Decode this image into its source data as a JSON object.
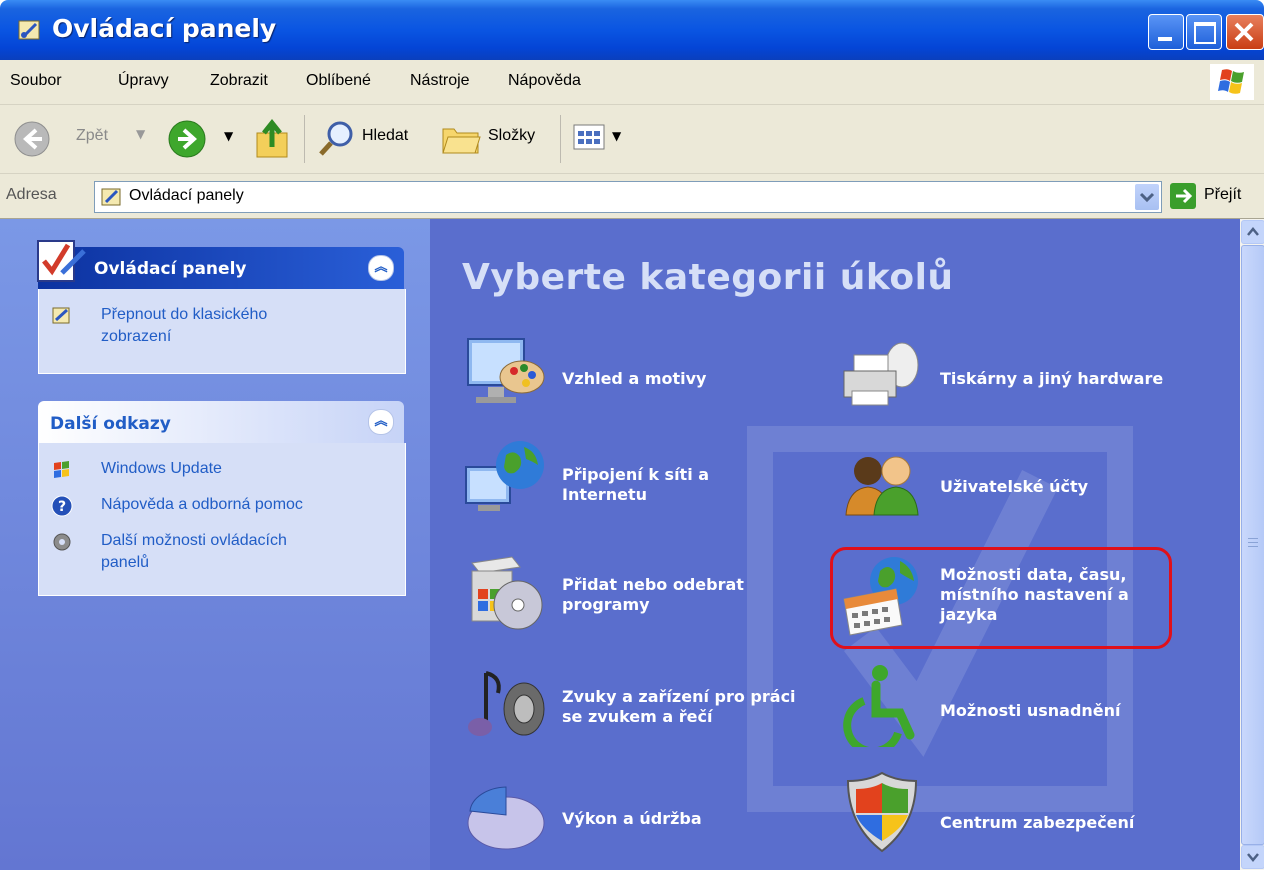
{
  "window": {
    "title": "Ovládací panely"
  },
  "menu": [
    "Soubor",
    "Úpravy",
    "Zobrazit",
    "Oblíbené",
    "Nástroje",
    "Nápověda"
  ],
  "toolbar": {
    "back": "Zpět",
    "search": "Hledat",
    "folders": "Složky"
  },
  "address": {
    "label": "Adresa",
    "value": "Ovládací panely",
    "go": "Přejít"
  },
  "sidebar": {
    "panel1": {
      "title": "Ovládací panely",
      "links": [
        "Přepnout do klasického",
        "zobrazení"
      ]
    },
    "panel2": {
      "title": "Další odkazy",
      "links": [
        "Windows Update",
        "Nápověda a odborná pomoc",
        "Další možnosti ovládacích",
        "panelů"
      ]
    }
  },
  "main": {
    "title": "Vyberte kategorii úkolů",
    "categories": [
      {
        "label": [
          "Vzhled a motivy"
        ],
        "icon": "appearance-icon"
      },
      {
        "label": [
          "Tiskárny a jiný hardware"
        ],
        "icon": "printer-icon"
      },
      {
        "label": [
          "Připojení k síti a",
          "Internetu"
        ],
        "icon": "network-icon"
      },
      {
        "label": [
          "Uživatelské účty"
        ],
        "icon": "users-icon"
      },
      {
        "label": [
          "Přidat nebo odebrat",
          "programy"
        ],
        "icon": "install-icon"
      },
      {
        "label": [
          "Možnosti data, času,",
          "místního nastavení a",
          "jazyka"
        ],
        "icon": "date-globe-icon"
      },
      {
        "label": [
          "Zvuky a zařízení pro práci",
          "se zvukem a řečí"
        ],
        "icon": "sound-icon"
      },
      {
        "label": [
          "Možnosti usnadnění"
        ],
        "icon": "accessibility-icon"
      },
      {
        "label": [
          "Výkon a údržba"
        ],
        "icon": "performance-icon"
      },
      {
        "label": [
          "Centrum zabezpečení"
        ],
        "icon": "security-icon"
      }
    ]
  }
}
